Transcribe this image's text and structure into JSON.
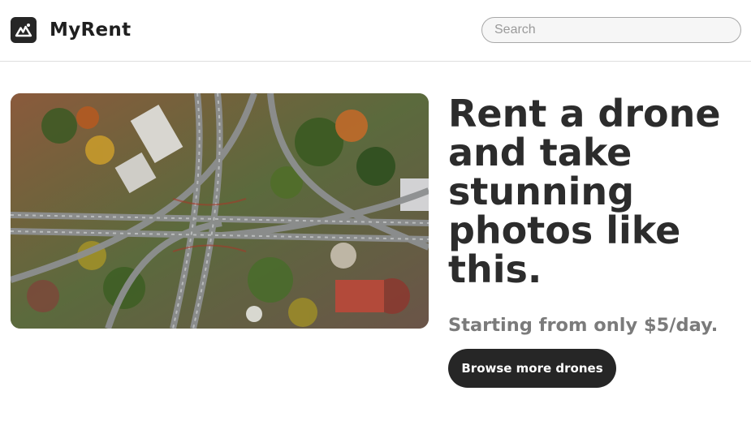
{
  "header": {
    "logo_icon": "mountain-logo-icon",
    "brand": "MyRent",
    "search_placeholder": "Search"
  },
  "hero": {
    "image": "aerial-highway-interchange-photo",
    "headline": "Rent a drone and take stunning photos like this.",
    "subheadline": "Starting from only $5/day.",
    "cta_label": "Browse more drones"
  },
  "colors": {
    "primary_dark": "#262626",
    "text_heading": "#2c2c2c",
    "text_muted": "#7b7b7b",
    "background": "#ffffff"
  }
}
